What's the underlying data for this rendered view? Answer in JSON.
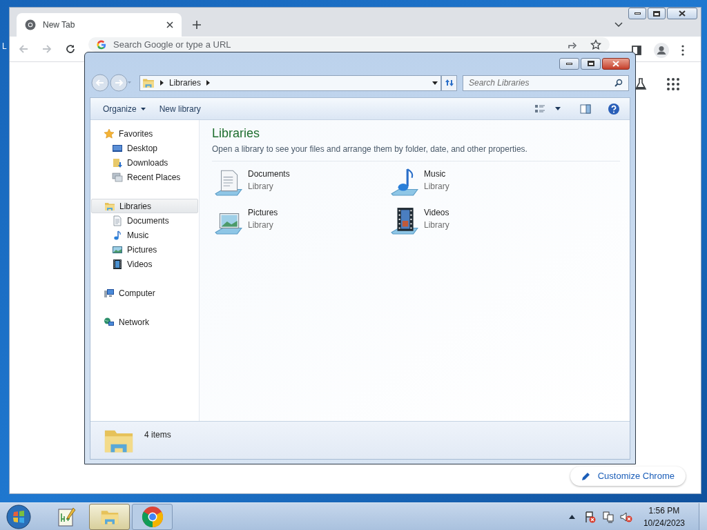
{
  "desktop": {
    "icon_label": "L"
  },
  "chrome": {
    "tabs": [
      {
        "title": "New Tab",
        "selected": true
      }
    ],
    "omnibox": {
      "placeholder": "Search Google or type a URL"
    },
    "customize_button": "Customize Chrome"
  },
  "explorer": {
    "breadcrumb": [
      "Libraries"
    ],
    "search": {
      "placeholder": "Search Libraries"
    },
    "commands": [
      {
        "label": "Organize",
        "has_menu": true
      },
      {
        "label": "New library",
        "has_menu": false
      }
    ],
    "nav": [
      {
        "label": "Favorites",
        "kind": "star",
        "selected": false,
        "children": [
          {
            "label": "Desktop",
            "kind": "desktop",
            "selected": false
          },
          {
            "label": "Downloads",
            "kind": "downloads",
            "selected": false
          },
          {
            "label": "Recent Places",
            "kind": "recent",
            "selected": false
          }
        ]
      },
      {
        "label": "Libraries",
        "kind": "library",
        "selected": true,
        "children": [
          {
            "label": "Documents",
            "kind": "documents",
            "selected": false
          },
          {
            "label": "Music",
            "kind": "music",
            "selected": false
          },
          {
            "label": "Pictures",
            "kind": "pictures",
            "selected": false
          },
          {
            "label": "Videos",
            "kind": "videos",
            "selected": false
          }
        ]
      },
      {
        "label": "Computer",
        "kind": "computer",
        "selected": false
      },
      {
        "label": "Network",
        "kind": "network",
        "selected": false
      }
    ],
    "content": {
      "title": "Libraries",
      "description": "Open a library to see your files and arrange them by folder, date, and other properties.",
      "items": [
        {
          "name": "Documents",
          "subtitle": "Library",
          "kind": "documents"
        },
        {
          "name": "Music",
          "subtitle": "Library",
          "kind": "music"
        },
        {
          "name": "Pictures",
          "subtitle": "Library",
          "kind": "pictures"
        },
        {
          "name": "Videos",
          "subtitle": "Library",
          "kind": "videos"
        }
      ]
    },
    "status": "4 items"
  },
  "taskbar": {
    "apps": [
      {
        "kind": "notepad",
        "selected": false
      },
      {
        "kind": "explorer",
        "selected": true
      },
      {
        "kind": "chrome",
        "selected": false
      }
    ],
    "clock": {
      "time": "1:56 PM",
      "date": "10/24/2023"
    }
  }
}
